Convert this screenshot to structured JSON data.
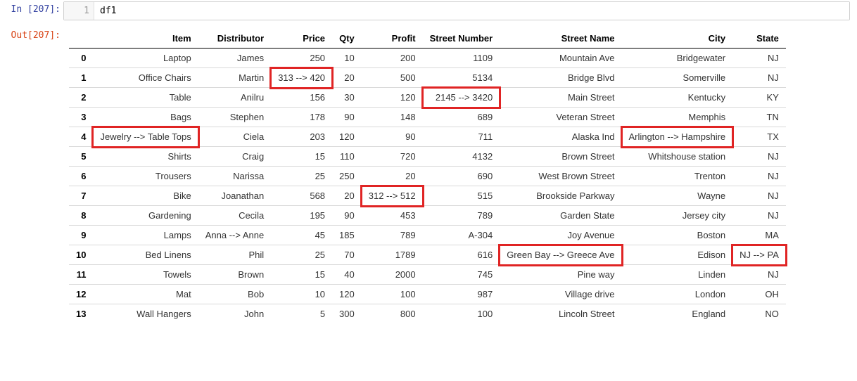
{
  "input": {
    "prompt_label": "In [207]:",
    "line_number": "1",
    "code": "df1"
  },
  "output": {
    "prompt_label": "Out[207]:",
    "columns": [
      "Item",
      "Distributor",
      "Price",
      "Qty",
      "Profit",
      "Street Number",
      "Street Name",
      "City",
      "State"
    ],
    "rows": [
      {
        "idx": "0",
        "Item": "Laptop",
        "Distributor": "James",
        "Price": "250",
        "Qty": "10",
        "Profit": "200",
        "Street Number": "1109",
        "Street Name": "Mountain Ave",
        "City": "Bridgewater",
        "State": "NJ"
      },
      {
        "idx": "1",
        "Item": "Office Chairs",
        "Distributor": "Martin",
        "Price": "313 --> 420",
        "Qty": "20",
        "Profit": "500",
        "Street Number": "5134",
        "Street Name": "Bridge Blvd",
        "City": "Somerville",
        "State": "NJ"
      },
      {
        "idx": "2",
        "Item": "Table",
        "Distributor": "Anilru",
        "Price": "156",
        "Qty": "30",
        "Profit": "120",
        "Street Number": "2145 --> 3420",
        "Street Name": "Main Street",
        "City": "Kentucky",
        "State": "KY"
      },
      {
        "idx": "3",
        "Item": "Bags",
        "Distributor": "Stephen",
        "Price": "178",
        "Qty": "90",
        "Profit": "148",
        "Street Number": "689",
        "Street Name": "Veteran Street",
        "City": "Memphis",
        "State": "TN"
      },
      {
        "idx": "4",
        "Item": "Jewelry --> Table Tops",
        "Distributor": "Ciela",
        "Price": "203",
        "Qty": "120",
        "Profit": "90",
        "Street Number": "711",
        "Street Name": "Alaska Ind",
        "City": "Arlington --> Hampshire",
        "State": "TX"
      },
      {
        "idx": "5",
        "Item": "Shirts",
        "Distributor": "Craig",
        "Price": "15",
        "Qty": "110",
        "Profit": "720",
        "Street Number": "4132",
        "Street Name": "Brown Street",
        "City": "Whitshouse station",
        "State": "NJ"
      },
      {
        "idx": "6",
        "Item": "Trousers",
        "Distributor": "Narissa",
        "Price": "25",
        "Qty": "250",
        "Profit": "20",
        "Street Number": "690",
        "Street Name": "West Brown Street",
        "City": "Trenton",
        "State": "NJ"
      },
      {
        "idx": "7",
        "Item": "Bike",
        "Distributor": "Joanathan",
        "Price": "568",
        "Qty": "20",
        "Profit": "312 --> 512",
        "Street Number": "515",
        "Street Name": "Brookside Parkway",
        "City": "Wayne",
        "State": "NJ"
      },
      {
        "idx": "8",
        "Item": "Gardening",
        "Distributor": "Cecila",
        "Price": "195",
        "Qty": "90",
        "Profit": "453",
        "Street Number": "789",
        "Street Name": "Garden State",
        "City": "Jersey city",
        "State": "NJ"
      },
      {
        "idx": "9",
        "Item": "Lamps",
        "Distributor": "Anna --> Anne",
        "Price": "45",
        "Qty": "185",
        "Profit": "789",
        "Street Number": "A-304",
        "Street Name": "Joy Avenue",
        "City": "Boston",
        "State": "MA"
      },
      {
        "idx": "10",
        "Item": "Bed Linens",
        "Distributor": "Phil",
        "Price": "25",
        "Qty": "70",
        "Profit": "1789",
        "Street Number": "616",
        "Street Name": "Green Bay --> Greece Ave",
        "City": "Edison",
        "State": "NJ --> PA"
      },
      {
        "idx": "11",
        "Item": "Towels",
        "Distributor": "Brown",
        "Price": "15",
        "Qty": "40",
        "Profit": "2000",
        "Street Number": "745",
        "Street Name": "Pine way",
        "City": "Linden",
        "State": "NJ"
      },
      {
        "idx": "12",
        "Item": "Mat",
        "Distributor": "Bob",
        "Price": "10",
        "Qty": "120",
        "Profit": "100",
        "Street Number": "987",
        "Street Name": "Village drive",
        "City": "London",
        "State": "OH"
      },
      {
        "idx": "13",
        "Item": "Wall Hangers",
        "Distributor": "John",
        "Price": "5",
        "Qty": "300",
        "Profit": "800",
        "Street Number": "100",
        "Street Name": "Lincoln Street",
        "City": "England",
        "State": "NO"
      }
    ],
    "highlights": [
      {
        "row": 1,
        "col": "Price"
      },
      {
        "row": 2,
        "col": "Street Number"
      },
      {
        "row": 4,
        "col": "Item"
      },
      {
        "row": 4,
        "col": "City"
      },
      {
        "row": 7,
        "col": "Profit"
      },
      {
        "row": 10,
        "col": "Street Name"
      },
      {
        "row": 10,
        "col": "State"
      }
    ]
  }
}
